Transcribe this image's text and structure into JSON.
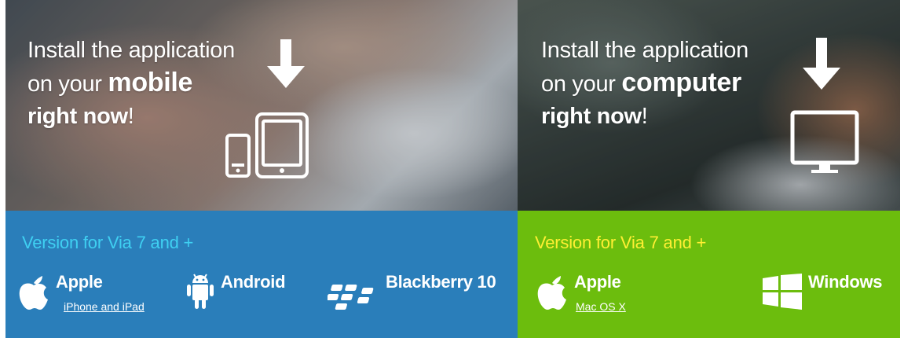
{
  "mobile": {
    "headline": {
      "line1": "Install the application",
      "line2_prefix": "on your ",
      "line2_bold": "mobile",
      "line3_bold": "right now",
      "line3_suffix": "!"
    },
    "version_label": "Version for Via 7 and +",
    "platforms": [
      {
        "name": "Apple",
        "subtitle": "iPhone and iPad",
        "icon": "apple-icon"
      },
      {
        "name": "Android",
        "icon": "android-icon"
      },
      {
        "name": "Blackberry 10",
        "icon": "blackberry-icon"
      }
    ],
    "colors": {
      "bar": "#2a7eba",
      "version_text": "#3fd0f2"
    }
  },
  "computer": {
    "headline": {
      "line1": "Install the application",
      "line2_prefix": "on your ",
      "line2_bold": "computer",
      "line3_bold": "right now",
      "line3_suffix": "!"
    },
    "version_label": "Version for Via 7 and +",
    "platforms": [
      {
        "name": "Apple",
        "subtitle": "Mac OS X",
        "icon": "apple-icon"
      },
      {
        "name": "Windows",
        "icon": "windows-icon"
      }
    ],
    "colors": {
      "bar": "#6cbd0d",
      "version_text": "#ffef33"
    }
  }
}
